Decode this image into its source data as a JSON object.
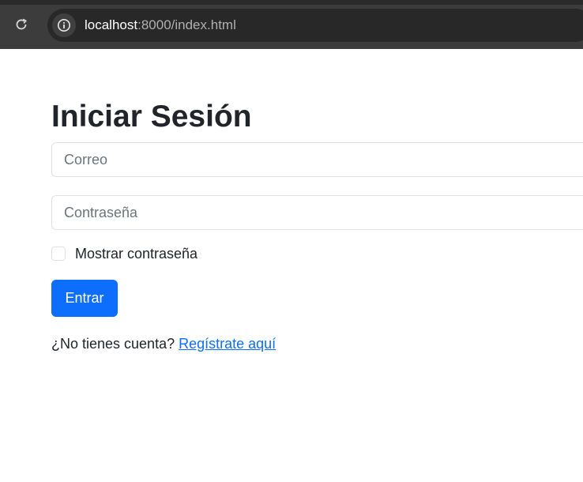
{
  "browser": {
    "url_host": "localhost",
    "url_path": ":8000/index.html"
  },
  "form": {
    "title": "Iniciar Sesión",
    "email_placeholder": "Correo",
    "password_placeholder": "Contraseña",
    "show_password_label": "Mostrar contraseña",
    "submit_label": "Entrar",
    "register_prompt": "¿No tienes cuenta?",
    "register_link": "Regístrate aquí"
  },
  "colors": {
    "primary": "#0d6efd",
    "browser_chrome": "#3c3c3c"
  }
}
